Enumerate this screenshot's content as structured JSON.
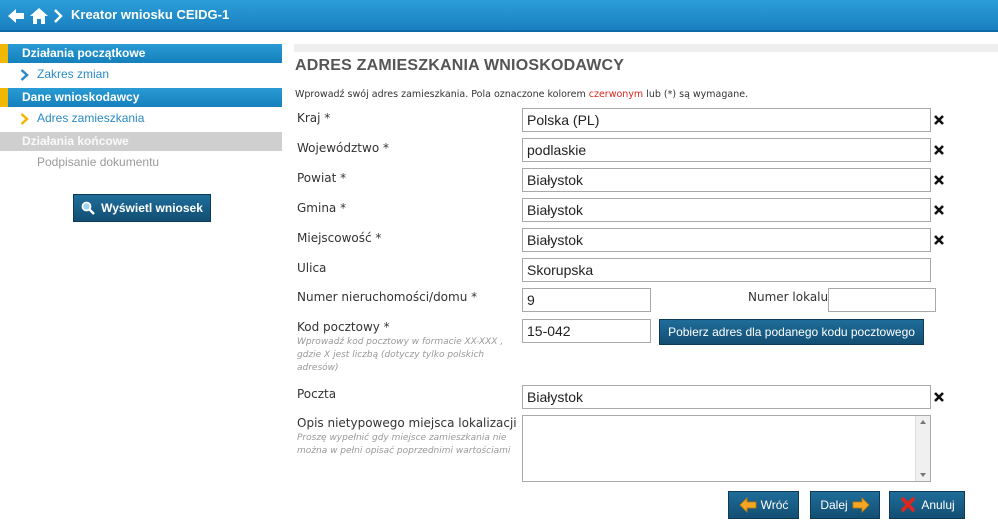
{
  "header": {
    "title": "Kreator wniosku CEIDG-1"
  },
  "sidebar": {
    "sections": [
      {
        "label": "Działania początkowe"
      },
      {
        "label": "Dane wnioskodawcy"
      },
      {
        "label": "Działania końcowe"
      }
    ],
    "items": [
      {
        "label": "Zakres zmian"
      },
      {
        "label": "Adres zamieszkania"
      },
      {
        "label": "Podpisanie dokumentu"
      }
    ],
    "view_button": "Wyświetl wniosek"
  },
  "main": {
    "title": "ADRES ZAMIESZKANIA WNIOSKODAWCY",
    "intro_before": "Wprowadź swój adres zamieszkania. Pola oznaczone kolorem ",
    "intro_red": "czerwonym",
    "intro_after": " lub (*) są wymagane.",
    "fields": {
      "kraj": {
        "label": "Kraj *",
        "value": "Polska (PL)"
      },
      "wojewodztwo": {
        "label": "Województwo *",
        "value": "podlaskie"
      },
      "powiat": {
        "label": "Powiat *",
        "value": "Białystok"
      },
      "gmina": {
        "label": "Gmina *",
        "value": "Białystok"
      },
      "miejscowosc": {
        "label": "Miejscowość *",
        "value": "Białystok"
      },
      "ulica": {
        "label": "Ulica",
        "value": "Skorupska"
      },
      "numer_domu": {
        "label": "Numer nieruchomości/domu *",
        "value": "9"
      },
      "numer_lokalu": {
        "label": "Numer lokalu",
        "value": ""
      },
      "kod_pocztowy": {
        "label": "Kod pocztowy *",
        "hint": "Wprowadź kod pocztowy w formacie XX-XXX , gdzie X jest liczbą (dotyczy tylko polskich adresów)",
        "value": "15-042"
      },
      "poczta": {
        "label": "Poczta",
        "value": "Białystok"
      },
      "opis": {
        "label": "Opis nietypowego miejsca lokalizacji",
        "hint": "Proszę wypełnić gdy miejsce zamieszkania nie można w pełni opisać poprzednimi wartościami",
        "value": ""
      }
    },
    "postal_button": "Pobierz adres dla podanego kodu pocztowego"
  },
  "actions": {
    "back": "Wróć",
    "next": "Dalej",
    "cancel": "Anuluj"
  },
  "colors": {
    "accent": "#1a7fc0",
    "section_marker": "#f2b700",
    "required_text": "#d9261c",
    "button": "#134e73"
  },
  "icons": [
    "back-arrow-icon",
    "home-icon",
    "chevron-right-icon",
    "magnifier-icon",
    "clear-x-icon",
    "arrow-left-icon",
    "arrow-right-icon",
    "cancel-x-icon"
  ]
}
